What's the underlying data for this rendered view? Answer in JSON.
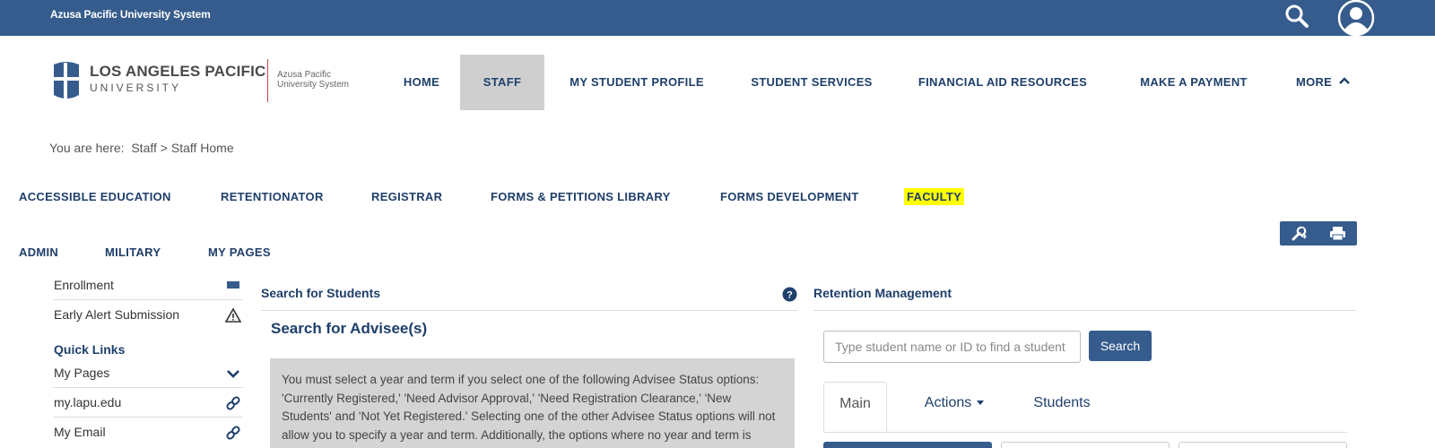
{
  "topbar": {
    "system_name": "Azusa Pacific University System"
  },
  "logo": {
    "name_line1": "LOS ANGELES PACIFIC",
    "name_line2": "UNIVERSITY",
    "sub_line1": "Azusa Pacific",
    "sub_line2": "University System"
  },
  "main_nav": [
    {
      "label": "HOME",
      "active": false
    },
    {
      "label": "STAFF",
      "active": true
    },
    {
      "label": "MY STUDENT PROFILE",
      "active": false
    },
    {
      "label": "STUDENT SERVICES",
      "active": false
    },
    {
      "label": "FINANCIAL AID RESOURCES",
      "active": false
    },
    {
      "label": "MAKE A PAYMENT",
      "active": false
    },
    {
      "label": "MORE",
      "active": false
    }
  ],
  "breadcrumb": {
    "prefix": "You are here:",
    "level1": "Staff",
    "separator": ">",
    "level2": "Staff Home"
  },
  "sub_nav": [
    {
      "label": "ACCESSIBLE EDUCATION",
      "highlight": false
    },
    {
      "label": "RETENTIONATOR",
      "highlight": false
    },
    {
      "label": "REGISTRAR",
      "highlight": false
    },
    {
      "label": "FORMS & PETITIONS LIBRARY",
      "highlight": false
    },
    {
      "label": "FORMS DEVELOPMENT",
      "highlight": false
    },
    {
      "label": "FACULTY",
      "highlight": true
    },
    {
      "label": "ADMIN",
      "highlight": false
    },
    {
      "label": "MILITARY",
      "highlight": false
    },
    {
      "label": "MY PAGES",
      "highlight": false
    }
  ],
  "sidebar": {
    "items": [
      {
        "label": "Enrollment",
        "icon": "enrollment-icon"
      },
      {
        "label": "Early Alert Submission",
        "icon": "warning-icon"
      }
    ],
    "quick_links_heading": "Quick Links",
    "quick_links": [
      {
        "label": "My Pages",
        "icon": "chevron-down-icon"
      },
      {
        "label": "my.lapu.edu",
        "icon": "link-icon"
      },
      {
        "label": "My Email",
        "icon": "link-icon"
      }
    ]
  },
  "search_students": {
    "title": "Search for Students",
    "advisee_title": "Search for Advisee(s)",
    "notice": "You must select a year and term if you select one of the following Advisee Status options: 'Currently Registered,' 'Need Advisor Approval,' 'Need Registration Clearance,' 'New Students' and 'Not Yet Registered.' Selecting one of the other Advisee Status options will not allow you to specify a year and term. Additionally, the options where no year and term is available will not display the Registration Clearance column."
  },
  "retention": {
    "title": "Retention Management",
    "search_placeholder": "Type student name or ID to find a student",
    "search_button": "Search",
    "tabs": [
      {
        "label": "Main",
        "active": true
      },
      {
        "label": "Actions",
        "active": false,
        "dropdown": true
      },
      {
        "label": "Students",
        "active": false
      }
    ]
  },
  "colors": {
    "brand": "#355c8c",
    "nav_text": "#1f3f6b",
    "highlight": "#ffff00",
    "active_nav_bg": "#cfcfcf"
  }
}
